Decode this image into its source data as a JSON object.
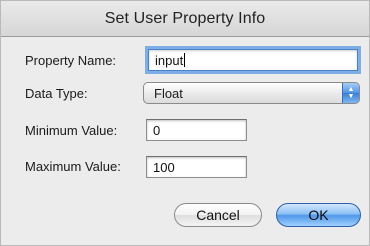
{
  "window": {
    "title": "Set User Property Info"
  },
  "form": {
    "property_name": {
      "label": "Property Name:",
      "value": "input"
    },
    "data_type": {
      "label": "Data Type:",
      "selected": "Float"
    },
    "minimum": {
      "label": "Minimum Value:",
      "value": "0"
    },
    "maximum": {
      "label": "Maximum Value:",
      "value": "100"
    }
  },
  "buttons": {
    "cancel": "Cancel",
    "ok": "OK"
  },
  "colors": {
    "accent": "#4f97ea",
    "dialog_bg": "#ececec"
  }
}
